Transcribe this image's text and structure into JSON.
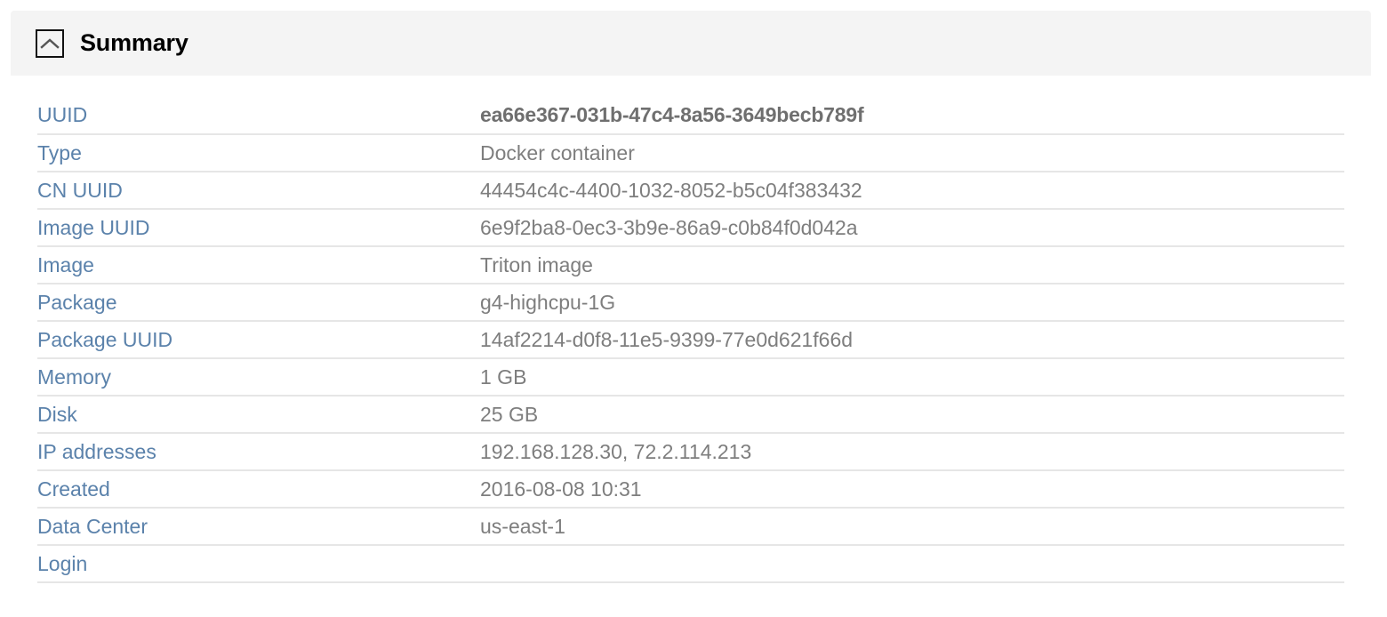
{
  "panel": {
    "title": "Summary",
    "collapse_icon": "chevron-up-boxed-icon",
    "header_bg": "#f4f4f4",
    "label_color": "#5b82ab",
    "value_color": "#7e7e7e",
    "row_border_color": "#e6e6e6"
  },
  "rows": [
    {
      "label": "UUID",
      "value": "ea66e367-031b-47c4-8a56-3649becb789f",
      "strong": true
    },
    {
      "label": "Type",
      "value": "Docker container"
    },
    {
      "label": "CN UUID",
      "value": "44454c4c-4400-1032-8052-b5c04f383432"
    },
    {
      "label": "Image UUID",
      "value": "6e9f2ba8-0ec3-3b9e-86a9-c0b84f0d042a"
    },
    {
      "label": "Image",
      "value": "Triton image"
    },
    {
      "label": "Package",
      "value": "g4-highcpu-1G"
    },
    {
      "label": "Package UUID",
      "value": "14af2214-d0f8-11e5-9399-77e0d621f66d"
    },
    {
      "label": "Memory",
      "value": "1 GB"
    },
    {
      "label": "Disk",
      "value": "25 GB"
    },
    {
      "label": "IP addresses",
      "value": "192.168.128.30, 72.2.114.213"
    },
    {
      "label": "Created",
      "value": "2016-08-08 10:31"
    },
    {
      "label": "Data Center",
      "value": "us-east-1"
    },
    {
      "label": "Login",
      "value": ""
    }
  ]
}
